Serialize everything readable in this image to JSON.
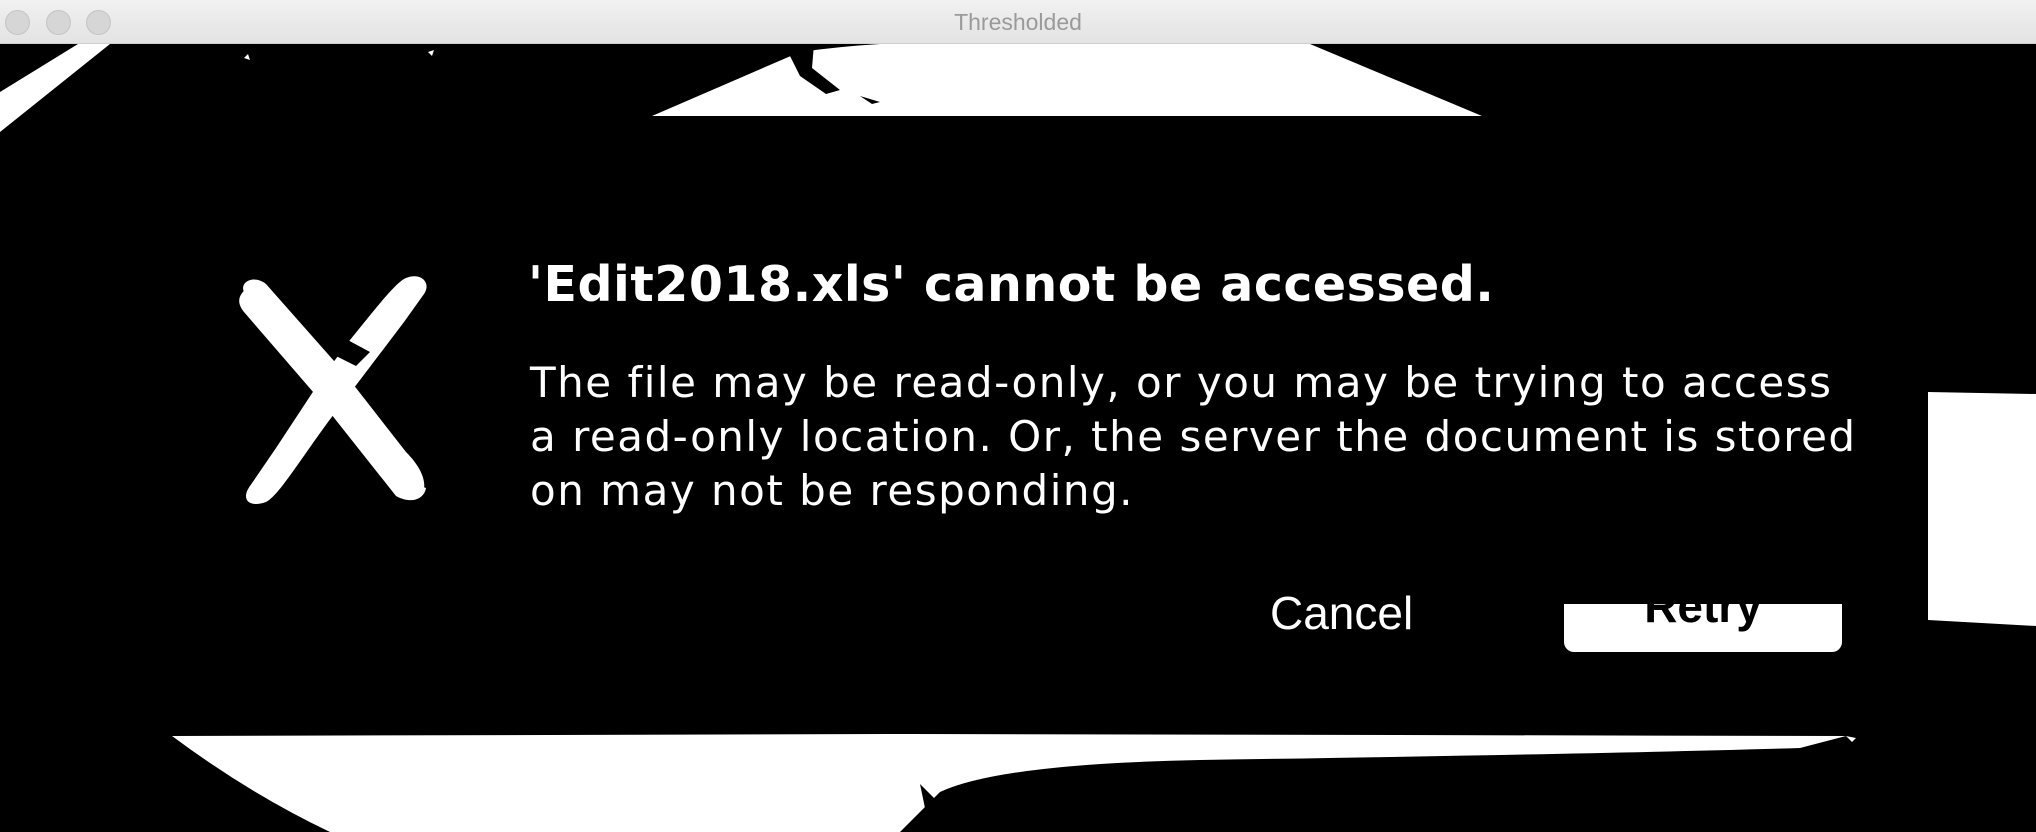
{
  "window": {
    "title": "Thresholded"
  },
  "dialog": {
    "title": "'Edit2018.xls' cannot be accessed.",
    "message": "The file may be read-only, or you may be trying to access a read-only location. Or, the server the document is stored on may not be responding.",
    "cancel_label": "Cancel",
    "retry_label": "Retry",
    "icon": "error-x-icon"
  },
  "colors": {
    "foreground": "#ffffff",
    "background": "#000000",
    "titlebar": "#e8e8e8"
  }
}
